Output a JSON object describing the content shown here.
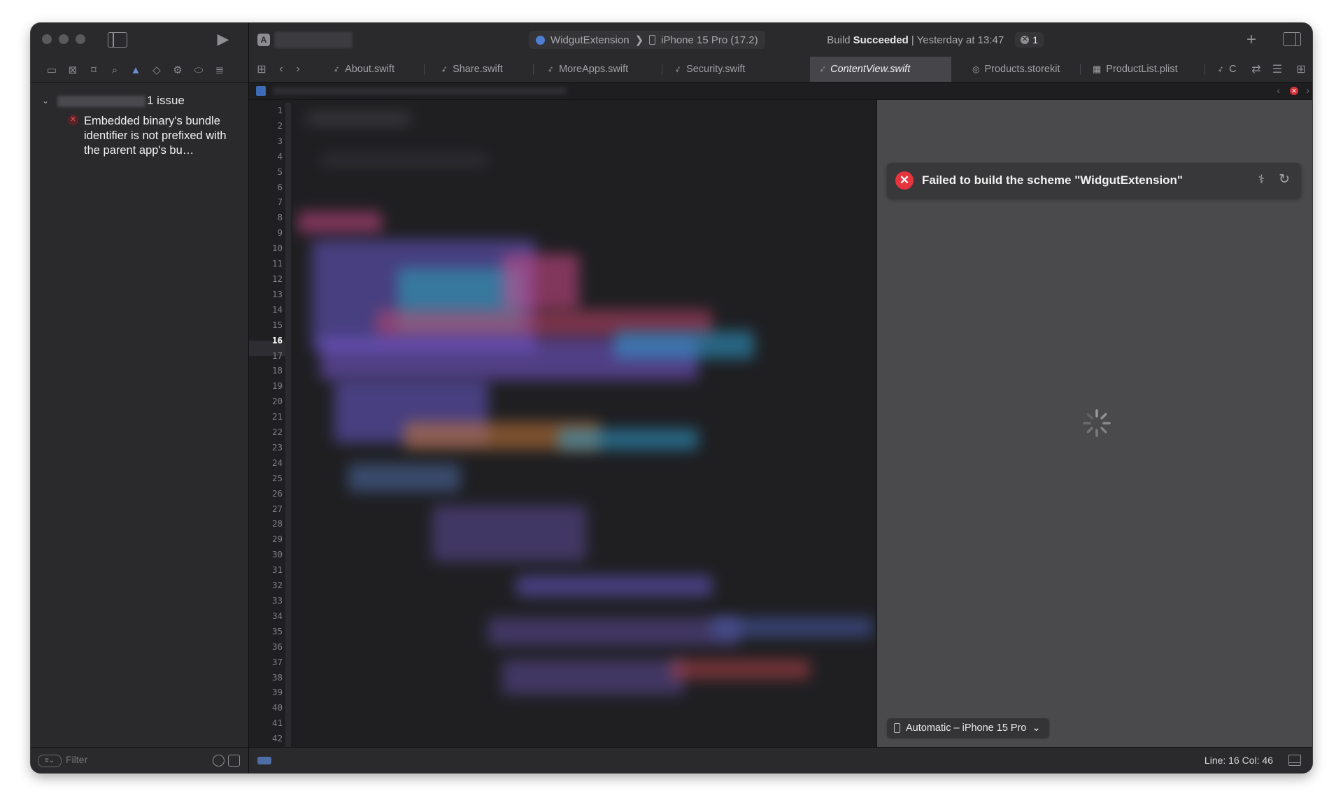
{
  "navigator": {
    "group_count": "1 issue",
    "issues": [
      {
        "text": "Embedded binary's bundle identifier is not prefixed with the parent app's bu…"
      }
    ],
    "filter_placeholder": "Filter"
  },
  "toolbar": {
    "scheme": "WidgutExtension",
    "destination": "iPhone 15 Pro (17.2)",
    "status_prefix": "Build",
    "status_result": "Succeeded",
    "status_time": "| Yesterday at 13:47",
    "error_count": "1"
  },
  "tabs": [
    {
      "label": "About.swift"
    },
    {
      "label": "Share.swift"
    },
    {
      "label": "MoreApps.swift"
    },
    {
      "label": "Security.swift"
    },
    {
      "label": "ContentView.swift"
    },
    {
      "label": "Products.storekit"
    },
    {
      "label": "ProductList.plist"
    },
    {
      "label": "C"
    }
  ],
  "editor": {
    "current_line": 16,
    "line_count": 42
  },
  "preview": {
    "error_title": "Failed to build the scheme \"WidgutExtension\"",
    "device": "Automatic – iPhone 15 Pro"
  },
  "statusbar": {
    "position": "Line: 16  Col: 46"
  }
}
